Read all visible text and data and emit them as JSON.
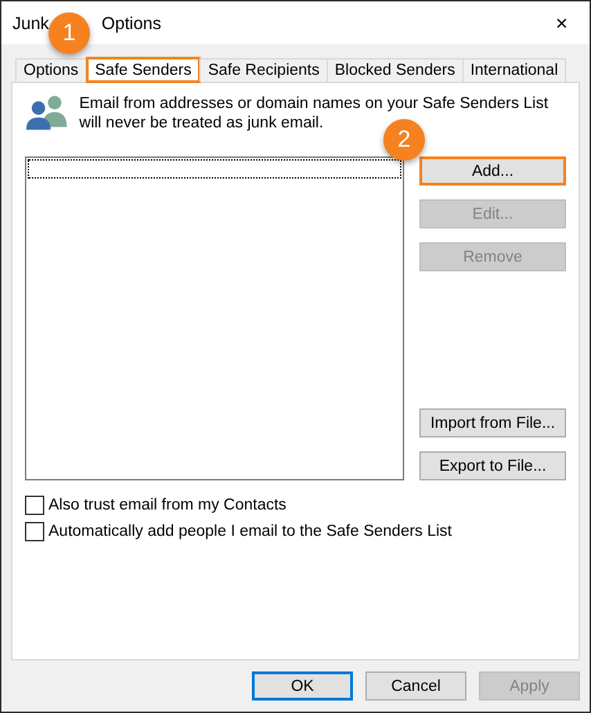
{
  "window": {
    "title_parts": [
      "Junk",
      "Options"
    ],
    "close": "✕"
  },
  "tabs": [
    {
      "label": "Options",
      "selected": false,
      "highlighted": false
    },
    {
      "label": "Safe Senders",
      "selected": true,
      "highlighted": true
    },
    {
      "label": "Safe Recipients",
      "selected": false,
      "highlighted": false
    },
    {
      "label": "Blocked Senders",
      "selected": false,
      "highlighted": false
    },
    {
      "label": "International",
      "selected": false,
      "highlighted": false
    }
  ],
  "description": "Email from addresses or domain names on your Safe Senders List will never be treated as junk email.",
  "side_buttons": [
    {
      "label": "Add...",
      "disabled": false,
      "highlighted": true
    },
    {
      "label": "Edit...",
      "disabled": true,
      "highlighted": false
    },
    {
      "label": "Remove",
      "disabled": true,
      "highlighted": false
    },
    {
      "label": "Import from File...",
      "disabled": false,
      "highlighted": false
    },
    {
      "label": "Export to File...",
      "disabled": false,
      "highlighted": false
    }
  ],
  "checkboxes": [
    {
      "label": "Also trust email from my Contacts",
      "checked": false
    },
    {
      "label": "Automatically add people I email to the Safe Senders List",
      "checked": false
    }
  ],
  "footer_buttons": [
    {
      "label": "OK",
      "disabled": false,
      "default": true
    },
    {
      "label": "Cancel",
      "disabled": false,
      "default": false
    },
    {
      "label": "Apply",
      "disabled": true,
      "default": false
    }
  ],
  "callouts": [
    {
      "label": "1"
    },
    {
      "label": "2"
    }
  ]
}
